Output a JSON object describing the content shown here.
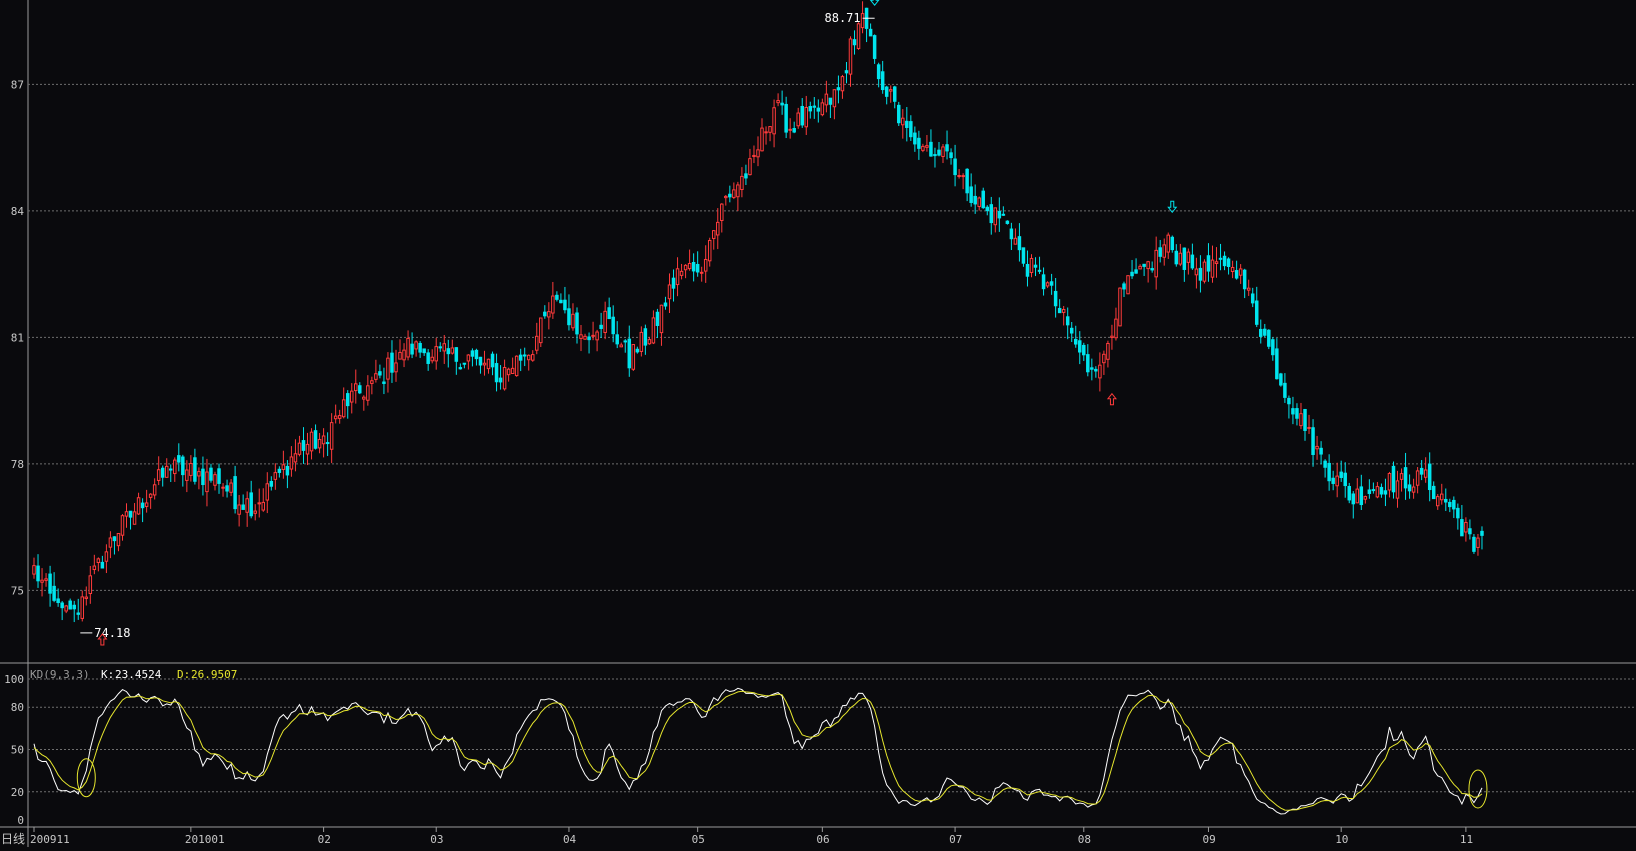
{
  "colors": {
    "background": "#0a0a0d",
    "up": "#ff3b3b",
    "down": "#00e5ee",
    "k_line": "#ffffff",
    "d_line": "#e6e62e",
    "grid": "#6e6e6e",
    "axis_text": "#c8c8c8",
    "frame": "#9a9a9a"
  },
  "chart_data": [
    {
      "type": "candlestick",
      "title": "",
      "ylim": [
        73.3,
        89.0
      ],
      "yticks": [
        75,
        78,
        81,
        84,
        87
      ],
      "grid": true,
      "xticks": [
        "200911",
        "201001",
        "02",
        "03",
        "04",
        "05",
        "06",
        "07",
        "08",
        "09",
        "10",
        "11"
      ],
      "xtick_bar_index": [
        0,
        39,
        72,
        100,
        133,
        165,
        196,
        229,
        261,
        292,
        325,
        356
      ],
      "bar_count": 361,
      "anchor_closes": [
        [
          0,
          75.5
        ],
        [
          6,
          74.5
        ],
        [
          10,
          74.4
        ],
        [
          13,
          75.0
        ],
        [
          20,
          76.3
        ],
        [
          30,
          77.5
        ],
        [
          34,
          77.9
        ],
        [
          40,
          77.8
        ],
        [
          46,
          77.6
        ],
        [
          50,
          77.2
        ],
        [
          55,
          77.0
        ],
        [
          60,
          77.6
        ],
        [
          66,
          78.4
        ],
        [
          72,
          78.6
        ],
        [
          78,
          79.5
        ],
        [
          86,
          80.0
        ],
        [
          92,
          80.8
        ],
        [
          100,
          80.6
        ],
        [
          108,
          80.5
        ],
        [
          116,
          80.1
        ],
        [
          124,
          80.8
        ],
        [
          130,
          82.0
        ],
        [
          136,
          81.0
        ],
        [
          142,
          81.5
        ],
        [
          148,
          80.5
        ],
        [
          154,
          81.2
        ],
        [
          160,
          82.5
        ],
        [
          166,
          82.8
        ],
        [
          172,
          84.3
        ],
        [
          178,
          85.0
        ],
        [
          184,
          86.5
        ],
        [
          188,
          86.0
        ],
        [
          194,
          86.3
        ],
        [
          200,
          86.8
        ],
        [
          204,
          88.2
        ],
        [
          206,
          88.5
        ],
        [
          210,
          87.3
        ],
        [
          216,
          86.0
        ],
        [
          220,
          85.3
        ],
        [
          226,
          85.6
        ],
        [
          232,
          84.6
        ],
        [
          236,
          84.0
        ],
        [
          242,
          83.8
        ],
        [
          246,
          82.8
        ],
        [
          252,
          82.2
        ],
        [
          258,
          81.0
        ],
        [
          262,
          80.3
        ],
        [
          266,
          80.6
        ],
        [
          270,
          82.0
        ],
        [
          276,
          82.6
        ],
        [
          282,
          83.2
        ],
        [
          286,
          82.8
        ],
        [
          292,
          82.5
        ],
        [
          298,
          82.9
        ],
        [
          304,
          81.5
        ],
        [
          310,
          80.0
        ],
        [
          316,
          78.8
        ],
        [
          322,
          77.8
        ],
        [
          328,
          77.2
        ],
        [
          334,
          77.5
        ],
        [
          340,
          77.6
        ],
        [
          346,
          77.6
        ],
        [
          352,
          77.0
        ],
        [
          356,
          76.4
        ],
        [
          358,
          76.0
        ],
        [
          360,
          76.5
        ]
      ],
      "annotations": [
        {
          "label": "88.71",
          "type": "high",
          "value": 88.71,
          "bar_index": 209
        },
        {
          "label": "74.18",
          "type": "low",
          "value": 74.18,
          "bar_index": 14
        }
      ],
      "markers": [
        {
          "type": "up-arrow",
          "bar_index": 17,
          "value": 74.2
        },
        {
          "type": "down-arrow",
          "bar_index": 209,
          "value": 88.71
        },
        {
          "type": "down-arrow",
          "bar_index": 283,
          "value": 83.8
        },
        {
          "type": "up-arrow",
          "bar_index": 268,
          "value": 79.9
        }
      ]
    },
    {
      "type": "line",
      "indicator": "KD(9,3,3)",
      "ylim": [
        0,
        100
      ],
      "yticks": [
        0,
        20,
        50,
        80,
        100
      ],
      "grid": true,
      "series": [
        {
          "name": "K",
          "color": "#ffffff",
          "last_value": "23.4524"
        },
        {
          "name": "D",
          "color": "#e6e62e",
          "last_value": "26.9507"
        }
      ],
      "highlights": [
        {
          "bar_index": 13,
          "value": 30
        },
        {
          "bar_index": 359,
          "value": 22
        }
      ]
    }
  ],
  "labels": {
    "period": "日线",
    "indicator_name": "KD(9,3,3)",
    "k_prefix": "K:",
    "k_value": "23.4524",
    "d_prefix": "D:",
    "d_value": "26.9507"
  }
}
